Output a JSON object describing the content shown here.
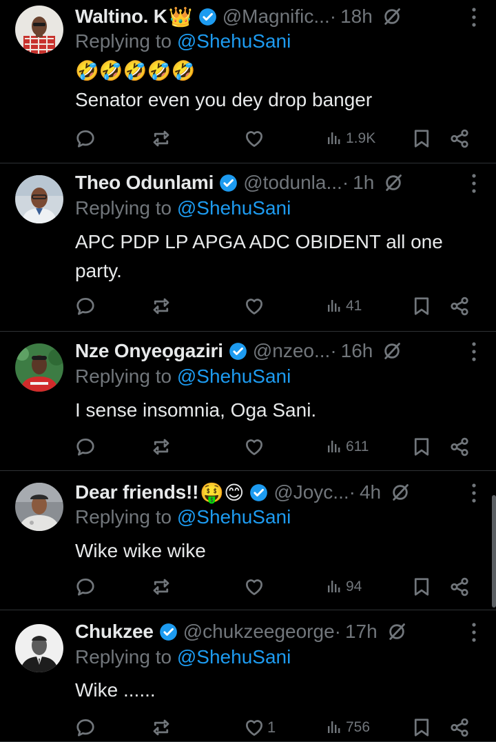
{
  "colors": {
    "background": "#000000",
    "text_primary": "#e7e9ea",
    "text_secondary": "#71767b",
    "accent": "#1d9bf0",
    "divider": "#2f3336"
  },
  "replies": [
    {
      "name": "Waltino. K",
      "name_emoji": "👑",
      "handle": "@Magnific...",
      "dot": "·",
      "time": "18h",
      "replying_prefix": "Replying to",
      "replying_to": "@ShehuSani",
      "text": "🤣🤣🤣🤣🤣\nSenator even you dey drop banger",
      "actions": {
        "reply_count": "",
        "repost_count": "",
        "like_count": "",
        "views": "1.9K"
      },
      "icons": [
        "verified-icon",
        "muted-icon",
        "more-icon",
        "reply-icon",
        "repost-icon",
        "like-icon",
        "views-icon",
        "bookmark-icon",
        "share-icon"
      ]
    },
    {
      "name": "Theo Odunlami",
      "name_emoji": "",
      "handle": "@todunla...",
      "dot": "·",
      "time": "1h",
      "replying_prefix": "Replying to",
      "replying_to": "@ShehuSani",
      "text": "APC PDP LP APGA ADC OBIDENT all one party.",
      "actions": {
        "reply_count": "",
        "repost_count": "",
        "like_count": "",
        "views": "41"
      }
    },
    {
      "name": "Nze Onyeọgaziri",
      "name_emoji": "",
      "handle": "@nzeo...",
      "dot": "·",
      "time": "16h",
      "replying_prefix": "Replying to",
      "replying_to": "@ShehuSani",
      "text": "I sense insomnia, Oga Sani.",
      "actions": {
        "reply_count": "",
        "repost_count": "",
        "like_count": "",
        "views": "611"
      }
    },
    {
      "name": "Dear friends!!",
      "name_emoji": "🤑😊",
      "handle": "@Joyc...",
      "dot": "·",
      "time": "4h",
      "replying_prefix": "Replying to",
      "replying_to": "@ShehuSani",
      "text": "Wike wike wike",
      "actions": {
        "reply_count": "",
        "repost_count": "",
        "like_count": "",
        "views": "94"
      }
    },
    {
      "name": "Chukzee",
      "name_emoji": "",
      "handle": "@chukzeegeorge",
      "dot": "·",
      "time": "17h",
      "replying_prefix": "Replying to",
      "replying_to": "@ShehuSani",
      "text": "Wike ......",
      "actions": {
        "reply_count": "",
        "repost_count": "",
        "like_count": "1",
        "views": "756"
      }
    }
  ]
}
